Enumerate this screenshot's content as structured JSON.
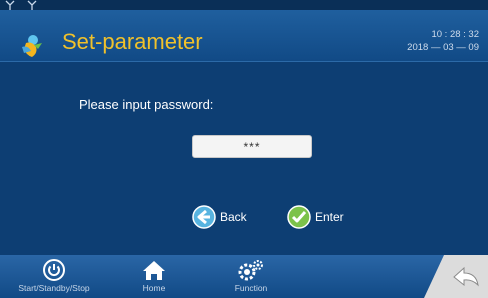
{
  "header": {
    "title": "Set-parameter",
    "time": "10 : 28 : 32",
    "date": "2018 — 03 — 09",
    "app_icon": "bird-logo-icon",
    "status_icons": [
      "antenna-icon",
      "antenna-icon"
    ]
  },
  "main": {
    "prompt": "Please input password:",
    "password_value": "***",
    "back_label": "Back",
    "enter_label": "Enter"
  },
  "nav": {
    "items": [
      {
        "label": "Start/Standby/Stop",
        "icon": "power-icon"
      },
      {
        "label": "Home",
        "icon": "home-icon"
      },
      {
        "label": "Function",
        "icon": "gears-icon"
      }
    ],
    "return_icon": "return-arrow-icon"
  },
  "colors": {
    "background": "#0d3e73",
    "title": "#f0c12b",
    "bar": "#1a5796",
    "back_button": "#58b4e0",
    "enter_button": "#7cc24a"
  }
}
